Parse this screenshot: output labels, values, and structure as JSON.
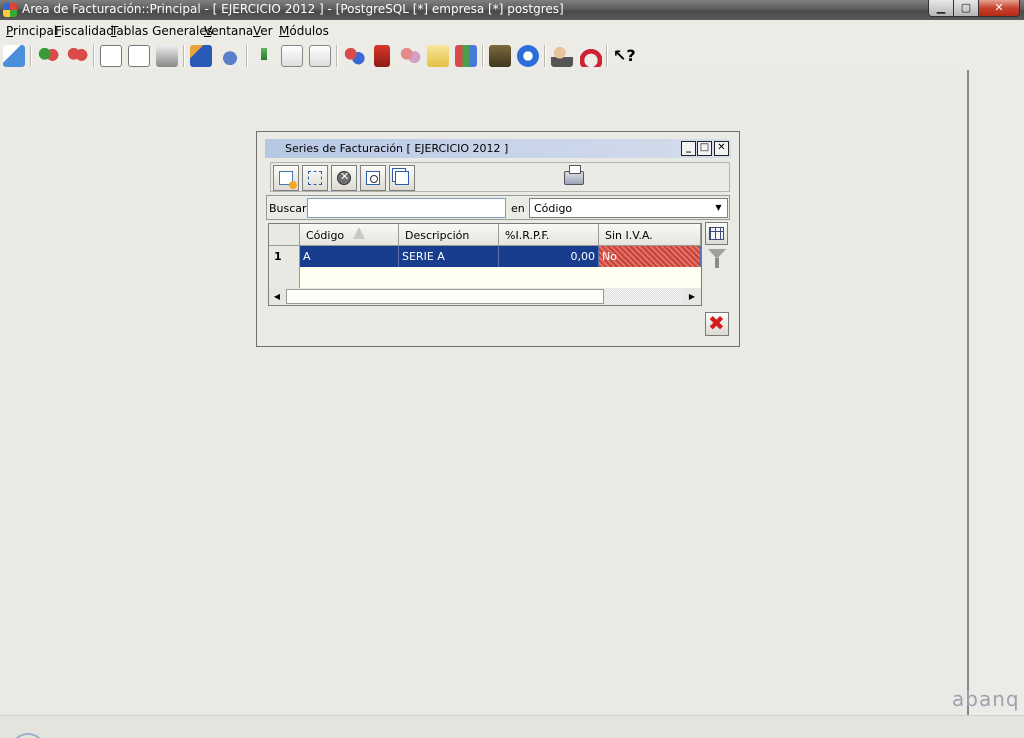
{
  "window": {
    "title": "Area de Facturación::Principal  - [ EJERCICIO 2012 ] - [PostgreSQL [*] empresa [*] postgres]",
    "min_glyph": "▁",
    "max_glyph": "▢",
    "close_glyph": "✕"
  },
  "menu": {
    "items": [
      {
        "label": "Principal",
        "accel": "P",
        "rest": "rincipal"
      },
      {
        "label": "Fiscalidad",
        "accel": "F",
        "rest": "iscalidad"
      },
      {
        "label": "Tablas Generales",
        "accel": "T",
        "rest": "ablas Generales"
      },
      {
        "label": "Ventana",
        "accel": "V",
        "rest": "entana"
      },
      {
        "label": "Ver",
        "accel": "V",
        "rest": "er"
      },
      {
        "label": "Módulos",
        "accel": "M",
        "rest": "ódulos"
      }
    ]
  },
  "toolbar": {
    "icons": [
      "home-module-icon",
      "users-green-icon",
      "users-red-icon",
      "calendar-05-icon",
      "document-ab-icon",
      "printer-pages-icon",
      "chart-icon",
      "padlock-icon",
      "download-arrow-icon",
      "export-doc-icon",
      "import-doc-icon",
      "network-users-icon",
      "calculator-icon",
      "users-pink-icon",
      "folder-notes-icon",
      "spreadsheet-icon",
      "stamp-icon",
      "globe-icon",
      "person-key-icon",
      "magnet-icon",
      "whats-this-help-icon"
    ]
  },
  "dialog": {
    "title": "Series de Facturación [ EJERCICIO 2012 ]",
    "min_glyph": "_",
    "max_glyph": "□",
    "close_glyph": "✕",
    "search": {
      "label": "Buscar",
      "value": "",
      "in_label": "en",
      "field_selected": "Código"
    },
    "table": {
      "columns": [
        "Código",
        "Descripción",
        "%I.R.P.F.",
        "Sin I.V.A."
      ],
      "rows": [
        {
          "index": "1",
          "codigo": "A",
          "descripcion": "SERIE A",
          "irpf": "0,00",
          "sin_iva": "No"
        }
      ]
    }
  },
  "branding": {
    "watermark": "abanq"
  },
  "colors": {
    "selection": "#183c8e",
    "highlight_red": "#c5423a",
    "title_bar": "#5d5d5d"
  }
}
